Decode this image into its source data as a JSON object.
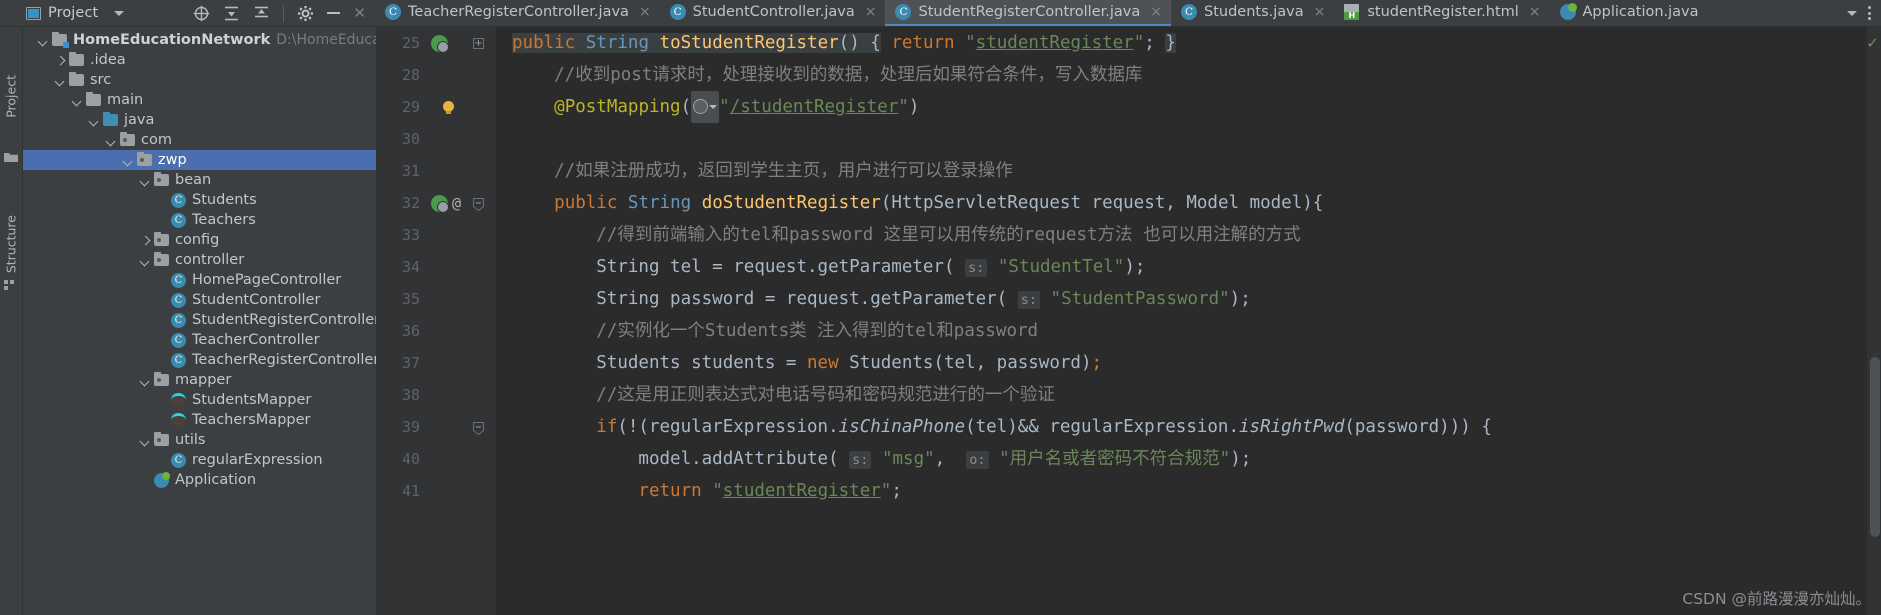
{
  "window": {
    "tool_window_title": "Project",
    "vertical_tabs": [
      "Project",
      "Structure"
    ]
  },
  "project_toolbar": {
    "icons": [
      "locate-icon",
      "expand-all-icon",
      "collapse-all-icon",
      "settings-icon",
      "minimize-icon",
      "close-icon"
    ]
  },
  "tabs": [
    {
      "label": "TeacherRegisterController.java",
      "icon": "java-class-icon",
      "active": false,
      "close": "×"
    },
    {
      "label": "StudentController.java",
      "icon": "java-class-icon",
      "active": false,
      "close": "×"
    },
    {
      "label": "StudentRegisterController.java",
      "icon": "java-class-icon",
      "active": true,
      "close": "×"
    },
    {
      "label": "Students.java",
      "icon": "java-class-icon",
      "active": false,
      "close": "×"
    },
    {
      "label": "studentRegister.html",
      "icon": "html-file-icon",
      "active": false,
      "close": "×"
    },
    {
      "label": "Application.java",
      "icon": "spring-boot-icon",
      "active": false,
      "close": ""
    }
  ],
  "tree": [
    {
      "label": "HomeEducationNetwork",
      "path": "D:\\HomeEducationNetwo",
      "indent": 0,
      "arrow": "open",
      "icon": "module-folder-icon",
      "bold": true,
      "selected": false
    },
    {
      "label": ".idea",
      "path": "",
      "indent": 1,
      "arrow": "closed",
      "icon": "folder-icon",
      "bold": false,
      "selected": false
    },
    {
      "label": "src",
      "path": "",
      "indent": 1,
      "arrow": "open",
      "icon": "folder-icon",
      "bold": false,
      "selected": false
    },
    {
      "label": "main",
      "path": "",
      "indent": 2,
      "arrow": "open",
      "icon": "folder-icon",
      "bold": false,
      "selected": false
    },
    {
      "label": "java",
      "path": "",
      "indent": 3,
      "arrow": "open",
      "icon": "source-folder-icon",
      "bold": false,
      "selected": false
    },
    {
      "label": "com",
      "path": "",
      "indent": 4,
      "arrow": "open",
      "icon": "package-icon",
      "bold": false,
      "selected": false
    },
    {
      "label": "zwp",
      "path": "",
      "indent": 5,
      "arrow": "open",
      "icon": "package-icon",
      "bold": false,
      "selected": true
    },
    {
      "label": "bean",
      "path": "",
      "indent": 6,
      "arrow": "open",
      "icon": "package-icon",
      "bold": false,
      "selected": false
    },
    {
      "label": "Students",
      "path": "",
      "indent": 7,
      "arrow": "none",
      "icon": "java-class-icon",
      "bold": false,
      "selected": false
    },
    {
      "label": "Teachers",
      "path": "",
      "indent": 7,
      "arrow": "none",
      "icon": "java-class-icon",
      "bold": false,
      "selected": false
    },
    {
      "label": "config",
      "path": "",
      "indent": 6,
      "arrow": "closed",
      "icon": "package-icon",
      "bold": false,
      "selected": false
    },
    {
      "label": "controller",
      "path": "",
      "indent": 6,
      "arrow": "open",
      "icon": "package-icon",
      "bold": false,
      "selected": false
    },
    {
      "label": "HomePageController",
      "path": "",
      "indent": 7,
      "arrow": "none",
      "icon": "java-class-icon",
      "bold": false,
      "selected": false
    },
    {
      "label": "StudentController",
      "path": "",
      "indent": 7,
      "arrow": "none",
      "icon": "java-class-icon",
      "bold": false,
      "selected": false
    },
    {
      "label": "StudentRegisterController",
      "path": "",
      "indent": 7,
      "arrow": "none",
      "icon": "java-class-icon",
      "bold": false,
      "selected": false
    },
    {
      "label": "TeacherController",
      "path": "",
      "indent": 7,
      "arrow": "none",
      "icon": "java-class-icon",
      "bold": false,
      "selected": false
    },
    {
      "label": "TeacherRegisterController",
      "path": "",
      "indent": 7,
      "arrow": "none",
      "icon": "java-class-icon",
      "bold": false,
      "selected": false
    },
    {
      "label": "mapper",
      "path": "",
      "indent": 6,
      "arrow": "open",
      "icon": "package-icon",
      "bold": false,
      "selected": false
    },
    {
      "label": "StudentsMapper",
      "path": "",
      "indent": 7,
      "arrow": "none",
      "icon": "mybatis-mapper-icon",
      "bold": false,
      "selected": false
    },
    {
      "label": "TeachersMapper",
      "path": "",
      "indent": 7,
      "arrow": "none",
      "icon": "mybatis-mapper-icon",
      "bold": false,
      "selected": false
    },
    {
      "label": "utils",
      "path": "",
      "indent": 6,
      "arrow": "open",
      "icon": "package-icon",
      "bold": false,
      "selected": false
    },
    {
      "label": "regularExpression",
      "path": "",
      "indent": 7,
      "arrow": "none",
      "icon": "java-class-icon",
      "bold": false,
      "selected": false
    },
    {
      "label": "Application",
      "path": "",
      "indent": 6,
      "arrow": "none",
      "icon": "spring-boot-icon",
      "bold": false,
      "selected": false
    }
  ],
  "editor": {
    "line_numbers": [
      "25",
      "28",
      "29",
      "30",
      "31",
      "32",
      "33",
      "34",
      "35",
      "36",
      "37",
      "38",
      "39",
      "40",
      "41"
    ],
    "gutter_markers": {
      "25": "run-method-icon",
      "29": "intention-bulb-icon",
      "32": "run-method-icon+annotation-marker"
    },
    "inspection_status": "✓",
    "code_lines": [
      "public String toStudentRegister() { return \"studentRegister\"; }",
      "//收到post请求时，处理接收到的数据，处理后如果符合条件，写入数据库",
      "@PostMapping(\"/studentRegister\")",
      "",
      "//如果注册成功，返回到学生主页，用户进行可以登录操作",
      "public String doStudentRegister(HttpServletRequest request, Model model){",
      "//得到前端输入的tel和password 这里可以用传统的request方法 也可以用注解的方式",
      "String tel = request.getParameter( s: \"StudentTel\");",
      "String password = request.getParameter( s: \"StudentPassword\");",
      "//实例化一个Students类 注入得到的tel和password",
      "Students students = new Students(tel, password);",
      "//这是用正则表达式对电话号码和密码规范进行的一个验证",
      "if(!(regularExpression.isChinaPhone(tel)&& regularExpression.isRightPwd(password))) {",
      "model.addAttribute( s: \"msg\",  o: \"用户名或者密码不符合规范\");",
      "return \"studentRegister\";"
    ],
    "hints": {
      "s": "s:",
      "o": "o:"
    }
  },
  "watermark": "CSDN @前路漫漫亦灿灿。",
  "colors": {
    "background": "#3c3f41",
    "editor_background": "#2b2b2b",
    "selection": "#4b6eaf",
    "accent": "#4a88c7",
    "keyword": "#cc7832",
    "string": "#6a8759",
    "comment": "#808080",
    "method": "#ffc66d",
    "annotation": "#bbb529"
  }
}
